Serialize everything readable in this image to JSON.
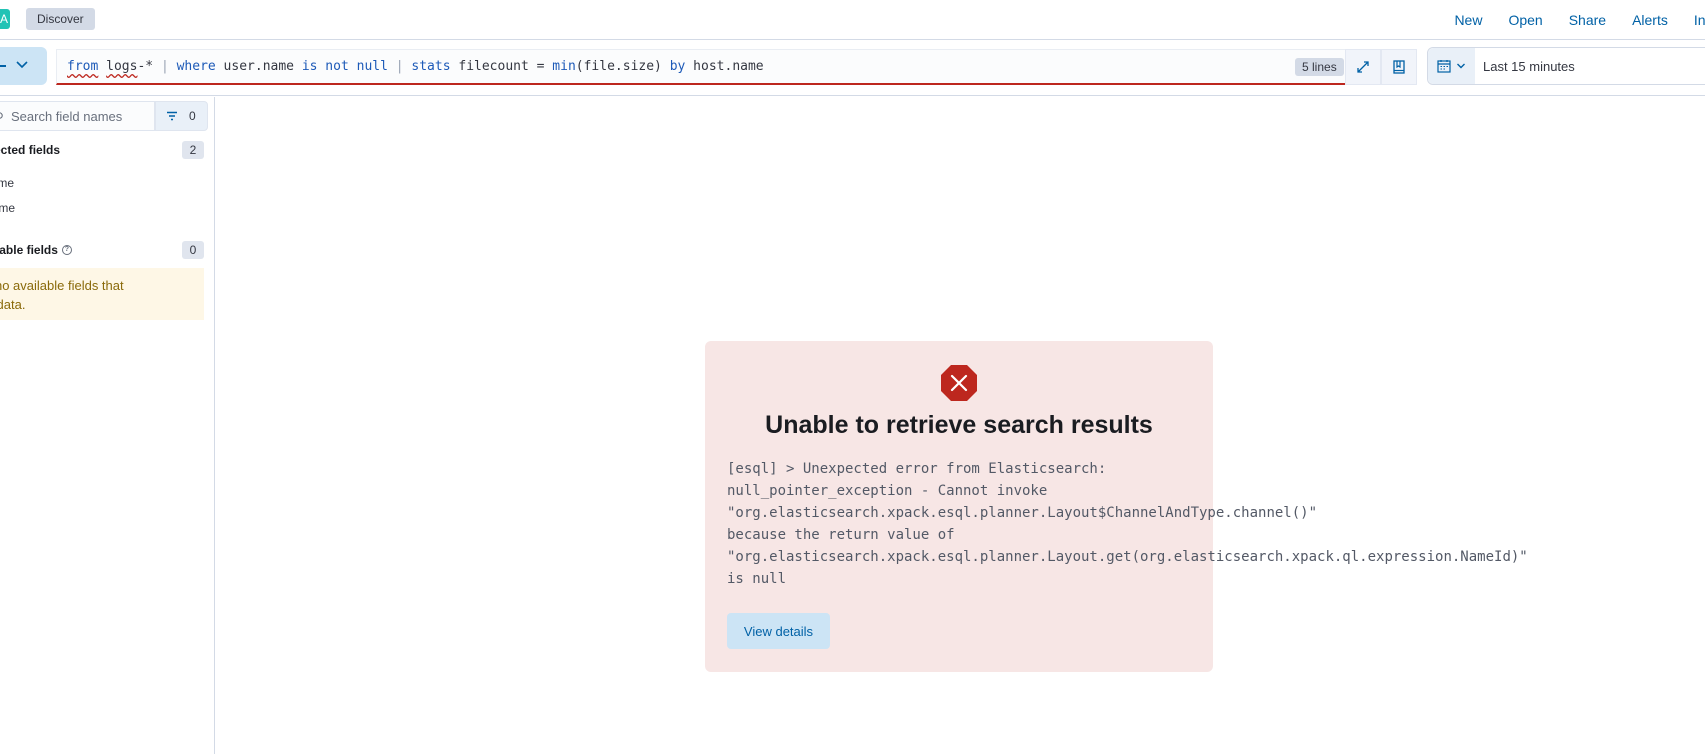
{
  "header": {
    "breadcrumb": "Discover",
    "links": [
      "New",
      "Open",
      "Share",
      "Alerts",
      "Inspect"
    ]
  },
  "query": {
    "segments": [
      {
        "text": "from",
        "cls": "kw squig"
      },
      {
        "text": " ",
        "cls": ""
      },
      {
        "text": "logs",
        "cls": "squig"
      },
      {
        "text": "-* ",
        "cls": ""
      },
      {
        "text": "|",
        "cls": "pipe"
      },
      {
        "text": " ",
        "cls": ""
      },
      {
        "text": "where",
        "cls": "kw"
      },
      {
        "text": " user.name ",
        "cls": ""
      },
      {
        "text": "is not null",
        "cls": "kw"
      },
      {
        "text": " ",
        "cls": ""
      },
      {
        "text": "|",
        "cls": "pipe"
      },
      {
        "text": " ",
        "cls": ""
      },
      {
        "text": "stats",
        "cls": "kw"
      },
      {
        "text": " filecount = ",
        "cls": ""
      },
      {
        "text": "min",
        "cls": "kw"
      },
      {
        "text": "(file.size) ",
        "cls": ""
      },
      {
        "text": "by",
        "cls": "kw"
      },
      {
        "text": " host.name",
        "cls": ""
      }
    ],
    "lines_badge": "5 lines",
    "error_count": "1"
  },
  "date_picker": {
    "label": "Last 15 minutes"
  },
  "sidebar": {
    "search_placeholder": "Search field names",
    "filter_count": "0",
    "selected_title": "Selected fields",
    "selected_count": "2",
    "selected_items": [
      "user.name",
      "host.name"
    ],
    "available_title": "Available fields",
    "available_count": "0",
    "callout_line1": "There are no available fields that",
    "callout_line2": "contain data."
  },
  "error": {
    "title": "Unable to retrieve search results",
    "message": "[esql] > Unexpected error from Elasticsearch:\nnull_pointer_exception - Cannot invoke\n\"org.elasticsearch.xpack.esql.planner.Layout$ChannelAndType.channel()\"\nbecause the return value of\n\"org.elasticsearch.xpack.esql.planner.Layout.get(org.elasticsearch.xpack.ql.expression.NameId)\"\nis null",
    "button": "View details"
  },
  "colors": {
    "primary": "#0061a6",
    "danger": "#bd271e",
    "error_panel_bg": "#f7e6e5",
    "callout_bg": "#fef7e6"
  }
}
